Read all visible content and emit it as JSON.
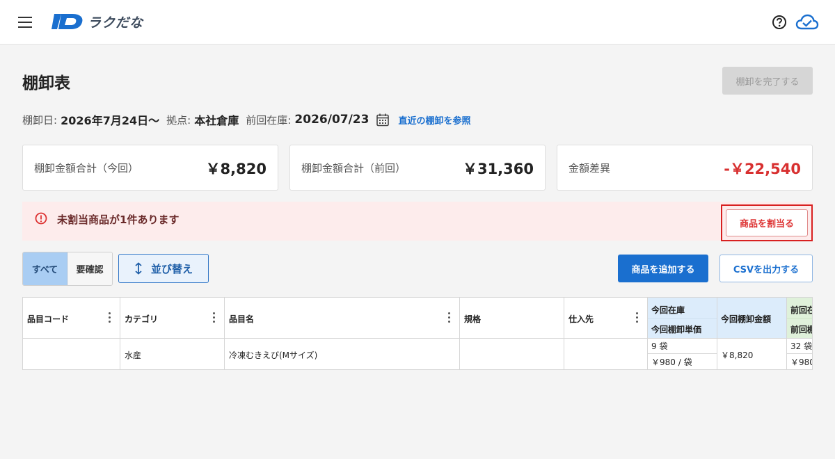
{
  "header": {
    "app_name": "ラクだな",
    "brand_color": "#1a6fcf",
    "icons": [
      "hamburger-icon",
      "logo-icon",
      "help-icon",
      "cloud-check-icon"
    ]
  },
  "page": {
    "title": "棚卸表",
    "complete_label": "棚卸を完了する"
  },
  "info": {
    "date_label": "棚卸日:",
    "date_value": "2026年7月24日〜",
    "location_label": "拠点:",
    "location_value": "本社倉庫",
    "prev_label": "前回在庫:",
    "prev_value": "2026/07/23",
    "ref_link": "直近の棚卸を参照"
  },
  "cards": [
    {
      "label": "棚卸金額合計（今回）",
      "value": "￥8,820"
    },
    {
      "label": "棚卸金額合計（前回）",
      "value": "￥31,360"
    },
    {
      "label": "金額差異",
      "value": "-￥22,540",
      "color": "#d83030"
    }
  ],
  "alert": {
    "message": "未割当商品が1件あります",
    "button": "商品を割当る"
  },
  "toolbar": {
    "filter_all": "すべて",
    "filter_check": "要確認",
    "sort": "並び替え",
    "add": "商品を追加する",
    "csv": "CSVを出力する"
  },
  "table": {
    "headers": {
      "code": "品目コード",
      "category": "カテゴリ",
      "name": "品目名",
      "spec": "規格",
      "supplier": "仕入先",
      "cur_stock": "今回在庫",
      "cur_unit": "今回棚卸単価",
      "cur_amount": "今回棚卸金額",
      "prev_stock": "前回在",
      "prev_unit": "前回棚"
    },
    "row": {
      "code": "",
      "category": "水産",
      "name": "冷凍むきえび(Mサイズ)",
      "spec": "",
      "supplier": "",
      "cur_stock": "9 袋",
      "cur_unit": "￥980 / 袋",
      "cur_amount": "￥8,820",
      "prev_stock": "32 袋",
      "prev_unit": "￥980"
    }
  }
}
